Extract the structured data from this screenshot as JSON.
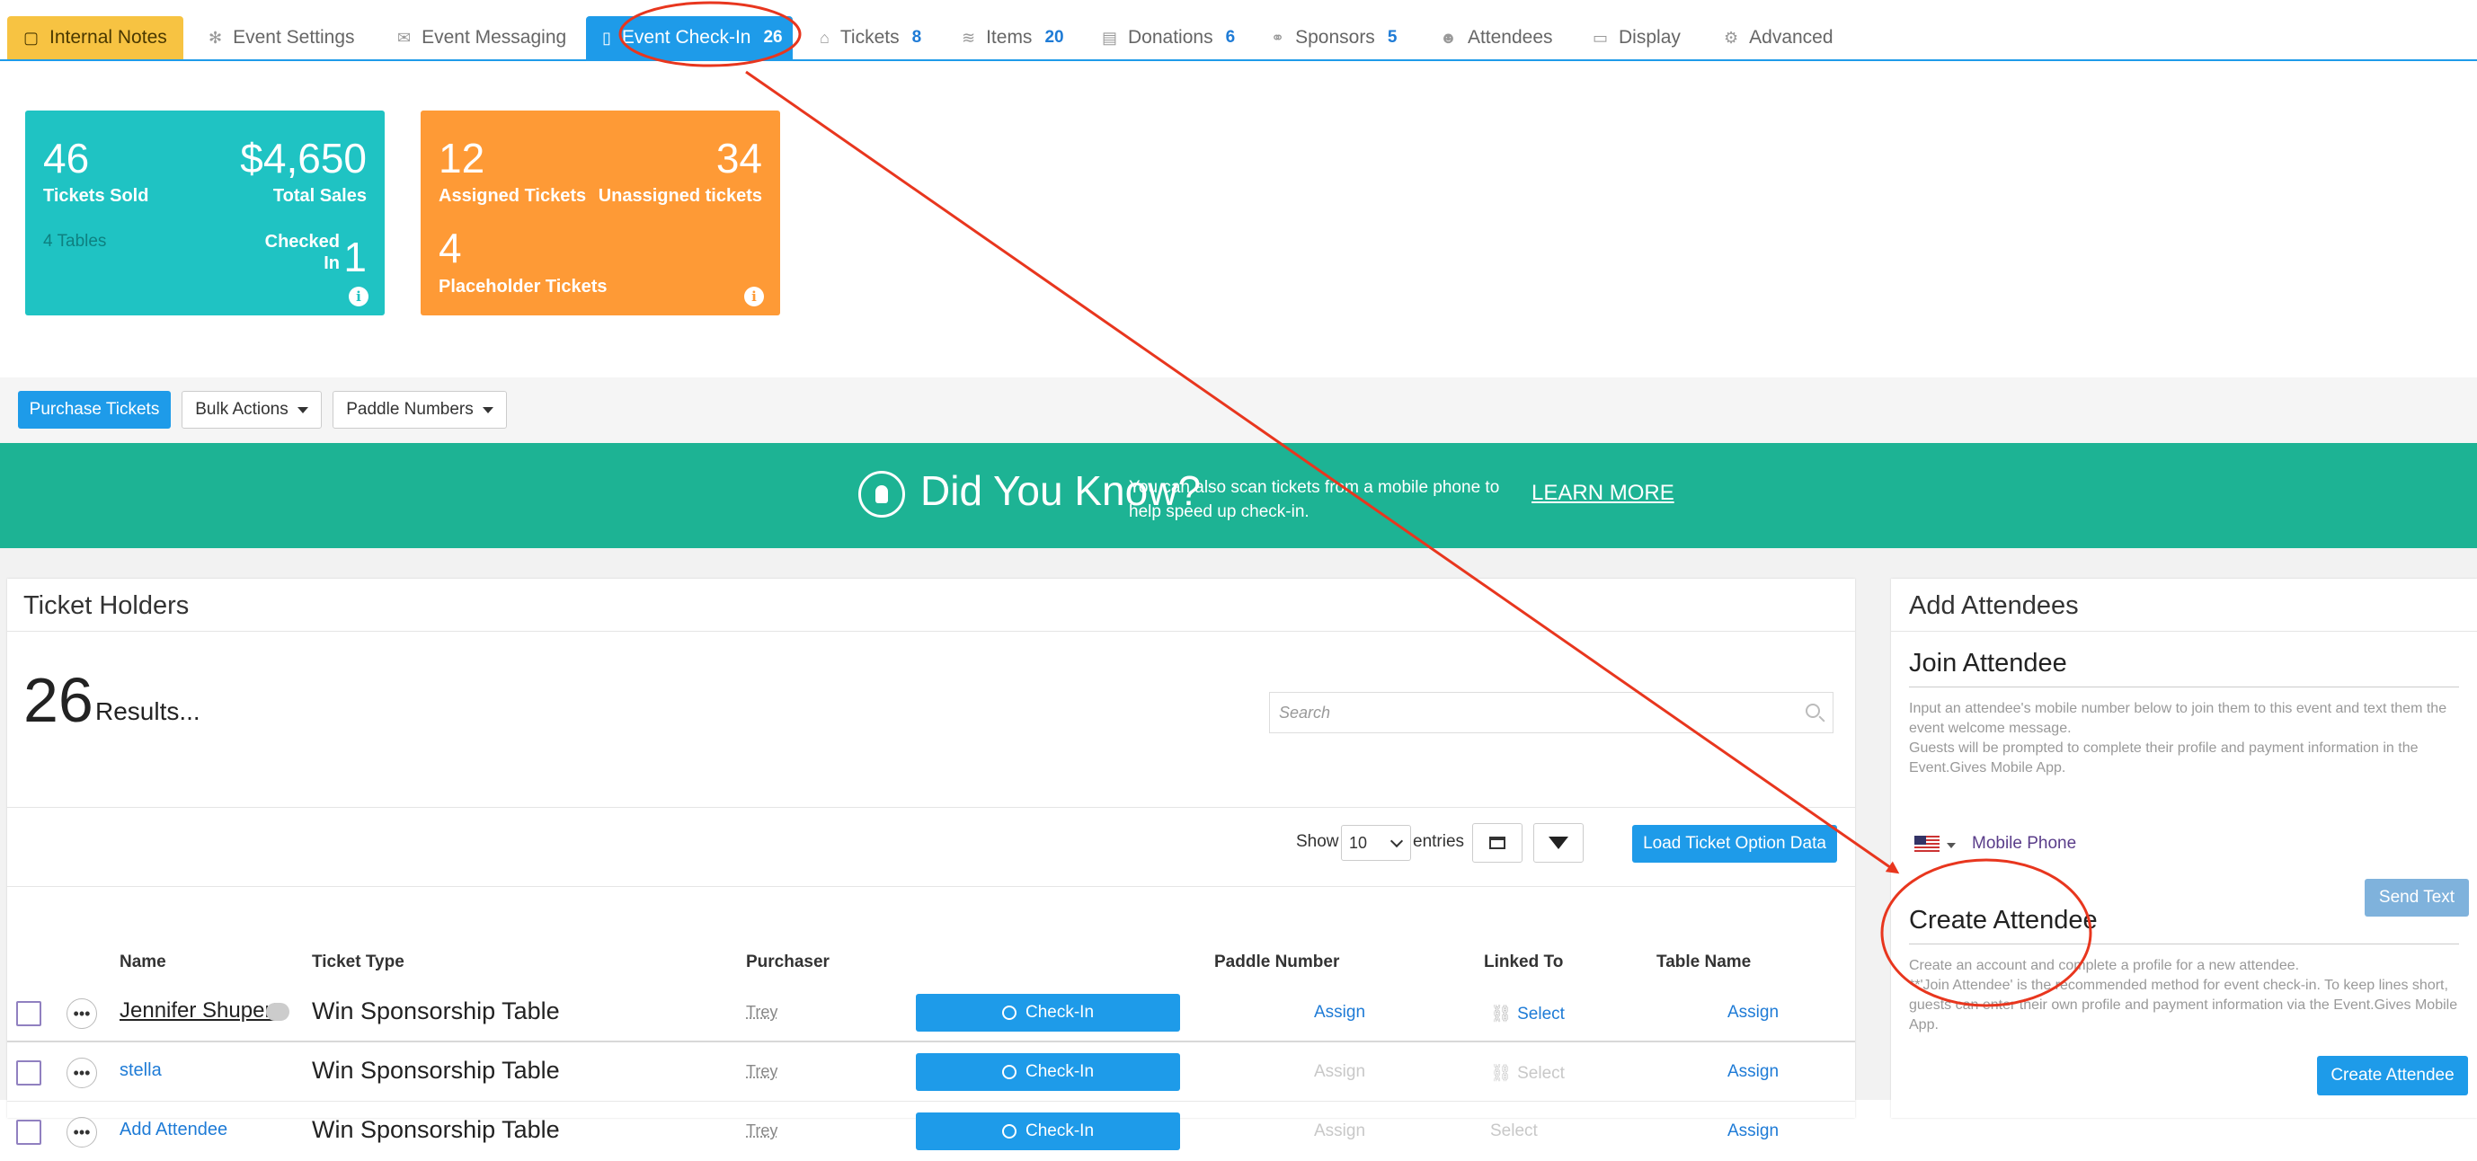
{
  "tabs": [
    {
      "label": "Internal Notes",
      "icon": "notes-icon",
      "count": ""
    },
    {
      "label": "Event Settings",
      "icon": "gear-icon",
      "count": ""
    },
    {
      "label": "Event Messaging",
      "icon": "envelope-icon",
      "count": ""
    },
    {
      "label": "Event Check-In",
      "icon": "clipboard-icon",
      "count": "26"
    },
    {
      "label": "Tickets",
      "icon": "tag-icon",
      "count": "8"
    },
    {
      "label": "Items",
      "icon": "layers-icon",
      "count": "20"
    },
    {
      "label": "Donations",
      "icon": "receipt-icon",
      "count": "6"
    },
    {
      "label": "Sponsors",
      "icon": "handshake-icon",
      "count": "5"
    },
    {
      "label": "Attendees",
      "icon": "users-icon",
      "count": ""
    },
    {
      "label": "Display",
      "icon": "monitor-icon",
      "count": ""
    },
    {
      "label": "Advanced",
      "icon": "cogs-icon",
      "count": ""
    }
  ],
  "stats": {
    "tickets_sold": "46",
    "tickets_sold_label": "Tickets Sold",
    "total_sales": "$4,650",
    "total_sales_label": "Total Sales",
    "tables": "4 Tables",
    "checked_in_label_1": "Checked",
    "checked_in_label_2": "In",
    "checked_in": "1",
    "assigned": "12",
    "assigned_label": "Assigned Tickets",
    "unassigned": "34",
    "unassigned_label": "Unassigned tickets",
    "placeholder": "4",
    "placeholder_label": "Placeholder Tickets",
    "colors": {
      "teal": "#1fc3c3",
      "orange": "#fe9a36"
    }
  },
  "actions": {
    "purchase": "Purchase Tickets",
    "bulk": "Bulk Actions",
    "paddle": "Paddle Numbers"
  },
  "banner": {
    "title": "Did You Know?",
    "text": "You can also scan tickets from a mobile phone to help speed up check-in.",
    "link": "LEARN MORE",
    "color": "#1db394"
  },
  "holders": {
    "title": "Ticket Holders",
    "count": "26",
    "results_label": "Results...",
    "search_placeholder": "Search",
    "show_label": "Show",
    "entries_value": "10",
    "entries_label": "entries",
    "load_button": "Load Ticket Option Data",
    "columns": {
      "name": "Name",
      "ticket_type": "Ticket Type",
      "purchaser": "Purchaser",
      "paddle": "Paddle Number",
      "linked": "Linked To",
      "table": "Table Name"
    },
    "rows": [
      {
        "name": "Jennifer Shupert",
        "ticket_type": "Win Sponsorship Table",
        "purchaser": "Trey",
        "checkin": "Check-In",
        "paddle": "Assign",
        "linked": "Select",
        "table": "Assign"
      },
      {
        "name": "stella",
        "ticket_type": "Win Sponsorship Table",
        "purchaser": "Trey",
        "checkin": "Check-In",
        "paddle": "Assign",
        "linked": "Select",
        "table": "Assign"
      },
      {
        "name": "Add Attendee",
        "ticket_type": "Win Sponsorship Table",
        "purchaser": "Trey",
        "checkin": "Check-In",
        "paddle": "Assign",
        "linked": "Select",
        "table": "Assign"
      }
    ]
  },
  "add": {
    "title": "Add Attendees",
    "join_title": "Join Attendee",
    "join_desc_1": "Input an attendee's mobile number below to join them to this event and text them the event welcome message.",
    "join_desc_2": "Guests will be prompted to complete their profile and payment information in the Event.Gives Mobile App.",
    "phone_label": "Mobile Phone",
    "send": "Send Text",
    "create_title": "Create Attendee",
    "create_desc_1": "Create an account and complete a profile for a new attendee.",
    "create_desc_2": "**'Join Attendee' is the recommended method for event check-in. To keep lines short, guests can enter their own profile and payment information via the Event.Gives Mobile App.",
    "create_button": "Create Attendee"
  },
  "annotation_color": "#e8361e"
}
